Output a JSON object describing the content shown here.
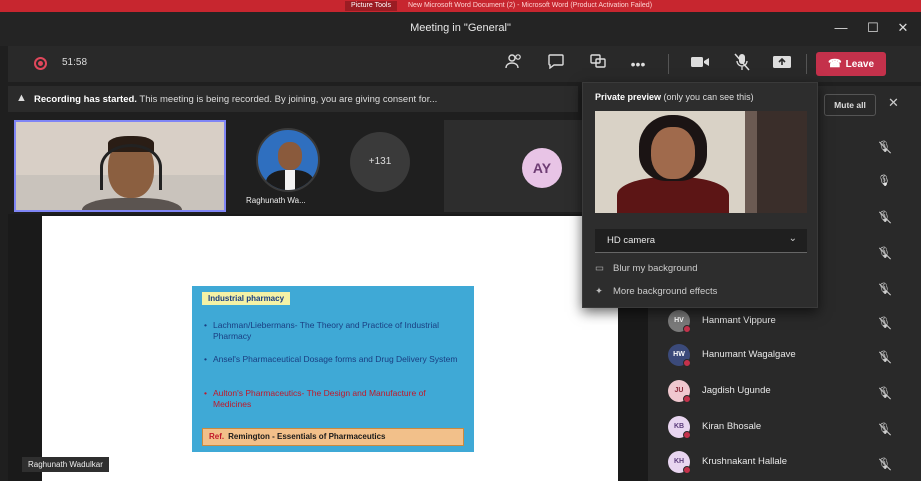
{
  "ribbon": {
    "picture_tools": "Picture Tools",
    "doc_title": "New Microsoft Word Document (2) - Microsoft Word (Product Activation Failed)"
  },
  "window": {
    "title": "Meeting in \"General\"",
    "minimize_glyph": "—",
    "maximize_glyph": "☐",
    "close_glyph": "✕"
  },
  "toolbar": {
    "timer": "51:58",
    "leave_label": "Leave",
    "icons": [
      "participants-icon",
      "chat-icon",
      "breakout-rooms-icon",
      "more-icon",
      "camera-icon",
      "mic-off-icon",
      "share-icon"
    ]
  },
  "banner": {
    "strong": "Recording has started.",
    "message": " This meeting is being recorded. By joining, you are giving consent for..."
  },
  "videos": {
    "tile2_name": "Raghunath Wa...",
    "more_count": "+131",
    "tile3_initials": "AY"
  },
  "slide": {
    "heading": "Industrial pharmacy",
    "bullets": [
      "Lachman/Liebermans- The Theory and Practice of Industrial Pharmacy",
      "Ansel's Pharmaceutical Dosage forms and Drug Delivery System",
      "Aulton's Pharmaceutics- The Design and Manufacture of Medicines"
    ],
    "ref_label": "Ref.",
    "ref_text": "Remington - Essentials of Pharmaceutics",
    "presenter": "Raghunath Wadulkar"
  },
  "preview": {
    "title_strong": "Private preview",
    "title_rest": " (only you can see this)",
    "camera": "HD camera",
    "option1": "Blur my background",
    "option2": "More background effects"
  },
  "panel": {
    "mute_all": "Mute all",
    "participants": [
      {
        "name": "Hanmant Vippure",
        "initials": "HV",
        "bg": "#7a7a7a",
        "fg": "#ffffff"
      },
      {
        "name": "Hanumant Wagalgave",
        "initials": "HW",
        "bg": "#3b4a7a",
        "fg": "#ffffff"
      },
      {
        "name": "Jagdish Ugunde",
        "initials": "JU",
        "bg": "#f0c8cf",
        "fg": "#8a2a3a"
      },
      {
        "name": "Kiran Bhosale",
        "initials": "KB",
        "bg": "#e8d5f0",
        "fg": "#5a3a7a"
      },
      {
        "name": "Krushnakant Hallale",
        "initials": "KH",
        "bg": "#e8d5f0",
        "fg": "#5a3a7a"
      }
    ]
  }
}
